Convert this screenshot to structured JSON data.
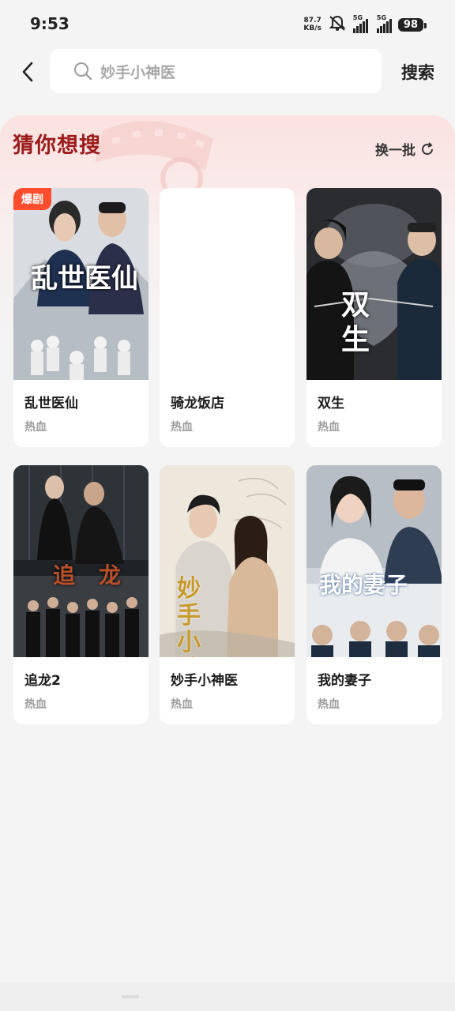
{
  "status": {
    "time": "9:53",
    "net_speed_value": "87.7",
    "net_speed_unit": "KB/s",
    "sim1": "5G",
    "sim2": "5G",
    "battery": "98"
  },
  "search": {
    "query": "妙手小神医",
    "button": "搜索"
  },
  "section": {
    "title": "猜你想搜",
    "refresh": "换一批"
  },
  "cards": [
    {
      "title": "乱世医仙",
      "tag": "热血",
      "badge": "爆剧",
      "poster_text": "乱世医仙"
    },
    {
      "title": "骑龙饭店",
      "tag": "热血"
    },
    {
      "title": "双生",
      "tag": "热血",
      "poster_text": "双生"
    },
    {
      "title": "追龙2",
      "tag": "热血",
      "poster_text": "追龙"
    },
    {
      "title": "妙手小神医",
      "tag": "热血",
      "poster_text": "妙手小神医"
    },
    {
      "title": "我的妻子",
      "tag": "热血",
      "poster_text": "我的妻子"
    }
  ],
  "colors": {
    "accent": "#9b1b1b",
    "badge": "#ff4d2e",
    "background": "#f4f4f5"
  }
}
